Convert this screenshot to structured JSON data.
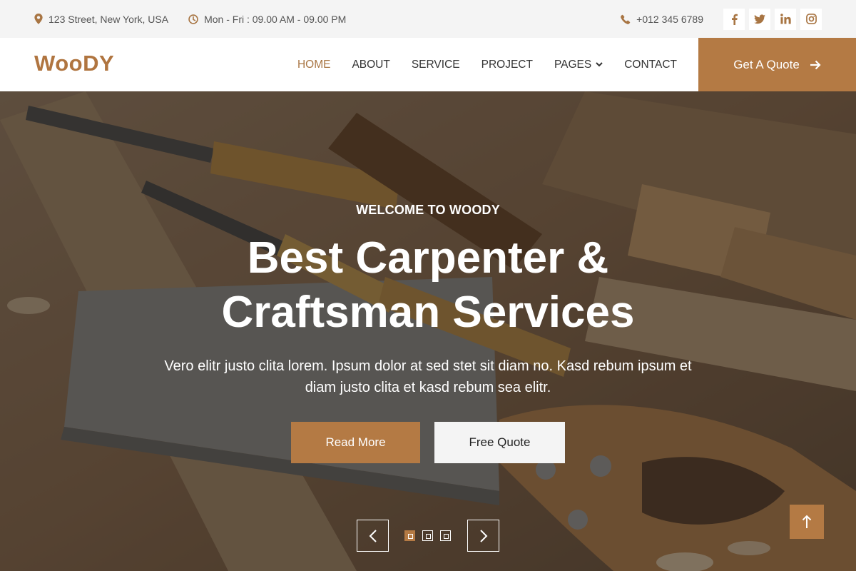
{
  "topbar": {
    "address": "123 Street, New York, USA",
    "hours": "Mon - Fri : 09.00 AM - 09.00 PM",
    "phone": "+012 345 6789",
    "social": [
      "facebook-icon",
      "twitter-icon",
      "linkedin-icon",
      "instagram-icon"
    ]
  },
  "nav": {
    "brand": "WooDY",
    "links": [
      "HOME",
      "ABOUT",
      "SERVICE",
      "PROJECT",
      "PAGES",
      "CONTACT"
    ],
    "active": "HOME",
    "cta": "Get A Quote"
  },
  "hero": {
    "kicker": "WELCOME TO WOODY",
    "headline_line1": "Best Carpenter &",
    "headline_line2": "Craftsman Services",
    "subtext": "Vero elitr justo clita lorem. Ipsum dolor at sed stet sit diam no. Kasd rebum ipsum et diam justo clita et kasd rebum sea elitr.",
    "primary_button": "Read More",
    "secondary_button": "Free Quote",
    "slides": 3,
    "active_slide": 1
  },
  "colors": {
    "accent": "#b47a44",
    "brand": "#b07540",
    "topbar_bg": "#f4f4f4"
  }
}
